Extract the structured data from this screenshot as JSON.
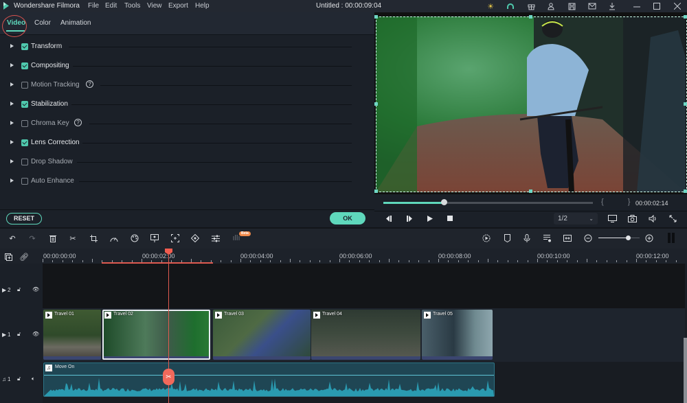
{
  "app": {
    "name": "Wondershare Filmora",
    "window_title": "Untitled : 00:00:09:04"
  },
  "menu": [
    "File",
    "Edit",
    "Tools",
    "View",
    "Export",
    "Help"
  ],
  "title_icons": [
    "lightbulb-icon",
    "headset-icon",
    "gift-icon",
    "account-icon",
    "save-icon",
    "mail-icon",
    "download-icon",
    "minimize-icon",
    "maximize-icon",
    "close-icon"
  ],
  "tabs": [
    {
      "label": "Video",
      "active": true
    },
    {
      "label": "Color",
      "active": false
    },
    {
      "label": "Animation",
      "active": false
    }
  ],
  "properties": [
    {
      "label": "Transform",
      "checked": true,
      "help": false
    },
    {
      "label": "Compositing",
      "checked": true,
      "help": false
    },
    {
      "label": "Motion Tracking",
      "checked": false,
      "help": true
    },
    {
      "label": "Stabilization",
      "checked": true,
      "help": false
    },
    {
      "label": "Chroma Key",
      "checked": false,
      "help": true
    },
    {
      "label": "Lens Correction",
      "checked": true,
      "help": false
    },
    {
      "label": "Drop Shadow",
      "checked": false,
      "help": false
    },
    {
      "label": "Auto Enhance",
      "checked": false,
      "help": false
    }
  ],
  "buttons": {
    "reset": "RESET",
    "ok": "OK",
    "help_glyph": "?"
  },
  "player": {
    "progress_fraction": 0.29,
    "brackets": "{ }",
    "current_time": "00:00:02:14",
    "ratio": "1/2",
    "ratio_chevron": "⌄"
  },
  "toolbar": {
    "beta_label": "Beta",
    "zoom_fraction": 0.72
  },
  "ruler": {
    "labels": [
      "00:00:00:00",
      "00:00:02:00",
      "00:00:04:00",
      "00:00:06:00",
      "00:00:08:00",
      "00:00:10:00",
      "00:00:12:00"
    ]
  },
  "tracks": {
    "video2_label": "2",
    "video1_label": "1",
    "audio1_label": "1"
  },
  "clips": [
    {
      "name": "Travel 01"
    },
    {
      "name": "Travel 02"
    },
    {
      "name": "Travel 03"
    },
    {
      "name": "Travel 04"
    },
    {
      "name": "Travel 05"
    }
  ],
  "audio_clip": {
    "name": "Move On",
    "icon": "♫"
  },
  "colors": {
    "accent": "#5fd8bc",
    "playhead": "#e05a50",
    "clip_border": "#3b4670",
    "audio_bg": "#1f4654"
  }
}
